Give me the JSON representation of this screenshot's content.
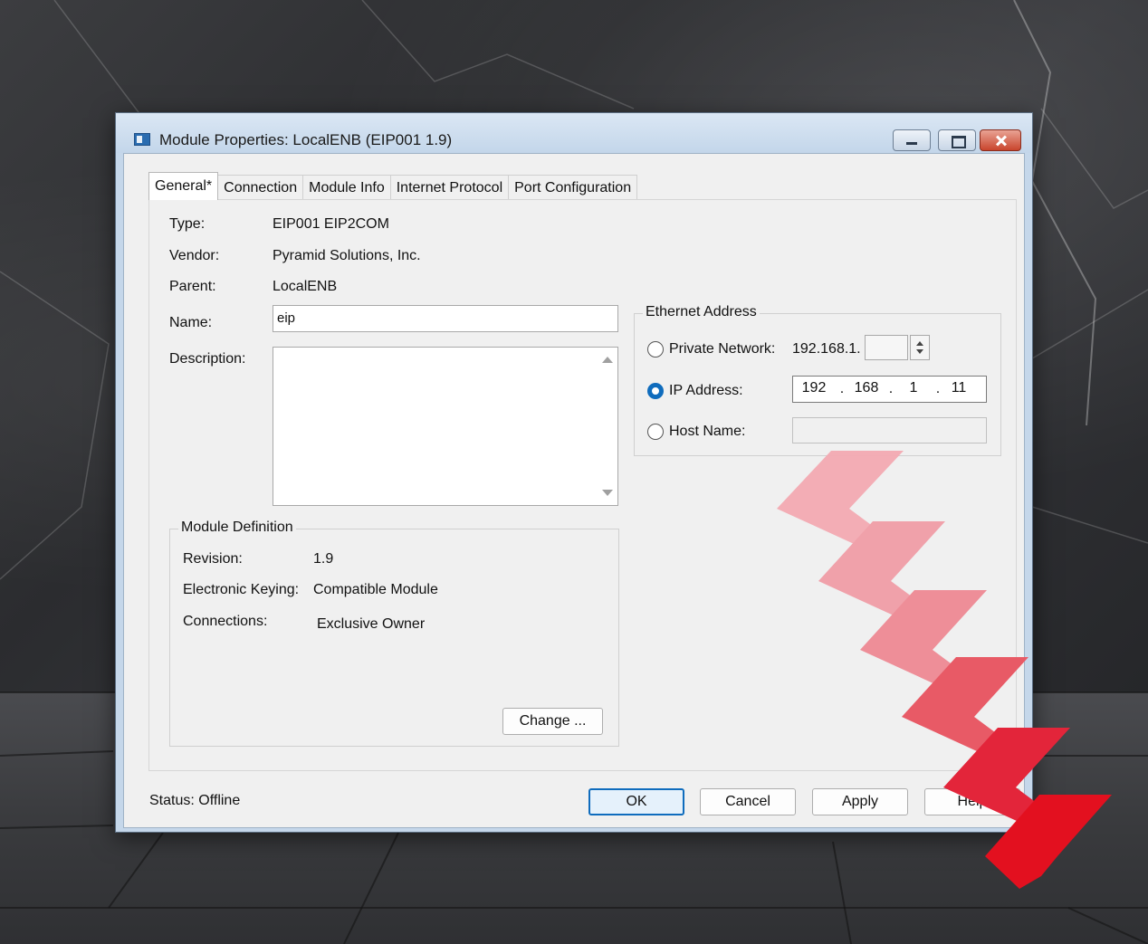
{
  "window": {
    "title": "Module Properties: LocalENB (EIP001 1.9)"
  },
  "tabs": [
    {
      "label": "General*"
    },
    {
      "label": "Connection"
    },
    {
      "label": "Module Info"
    },
    {
      "label": "Internet Protocol"
    },
    {
      "label": "Port Configuration"
    }
  ],
  "general": {
    "type_label": "Type:",
    "type_value": "EIP001 EIP2COM",
    "vendor_label": "Vendor:",
    "vendor_value": "Pyramid Solutions, Inc.",
    "parent_label": "Parent:",
    "parent_value": "LocalENB",
    "name_label": "Name:",
    "name_value": "eip",
    "description_label": "Description:",
    "description_value": ""
  },
  "module_definition": {
    "title": "Module Definition",
    "revision_label": "Revision:",
    "revision_value": "1.9",
    "keying_label": "Electronic Keying:",
    "keying_value": "Compatible Module",
    "connections_label": "Connections:",
    "connections_value": "Exclusive Owner",
    "change_button": "Change ..."
  },
  "ethernet": {
    "title": "Ethernet Address",
    "private_label": "Private Network:",
    "private_prefix": "192.168.1.",
    "private_value": "",
    "ip_label": "IP Address:",
    "ip_octets": [
      "192",
      "168",
      "1",
      "11"
    ],
    "ip_dot": ".",
    "host_label": "Host Name:",
    "host_value": "",
    "selected": "ip"
  },
  "footer": {
    "status_label": "Status:",
    "status_value": "Offline",
    "ok": "OK",
    "cancel": "Cancel",
    "apply": "Apply",
    "help": "Help"
  },
  "colors": {
    "accent": "#0f6cbd",
    "chevron_light": "#f2a9b1",
    "chevron_dark": "#e3101f"
  }
}
